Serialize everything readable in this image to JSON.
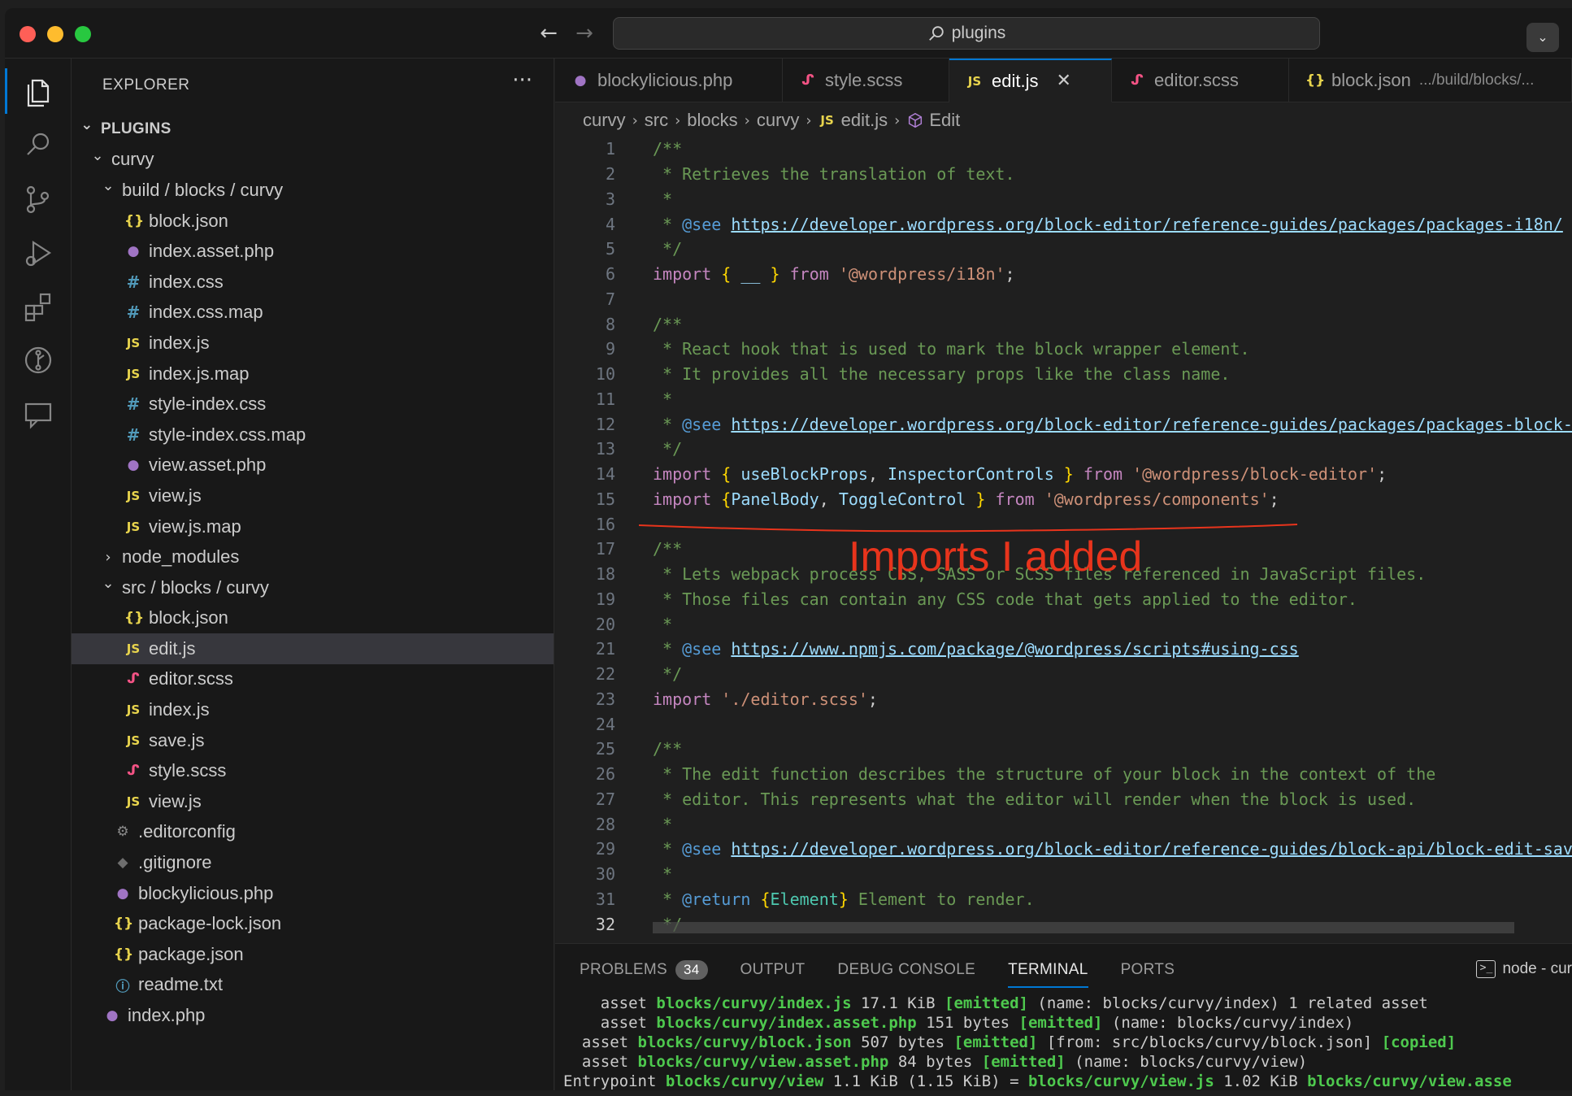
{
  "window": {
    "search_text": "plugins"
  },
  "sidebar": {
    "header": "EXPLORER",
    "more": "···",
    "tree": [
      {
        "indent": 0,
        "chevron": "v",
        "icon": "",
        "label": "PLUGINS",
        "section": true
      },
      {
        "indent": 1,
        "chevron": "v",
        "icon": "",
        "label": "curvy"
      },
      {
        "indent": 2,
        "chevron": "v",
        "icon": "",
        "label": "build / blocks / curvy"
      },
      {
        "indent": 3,
        "chevron": "",
        "icon": "json",
        "label": "block.json"
      },
      {
        "indent": 3,
        "chevron": "",
        "icon": "php",
        "label": "index.asset.php"
      },
      {
        "indent": 3,
        "chevron": "",
        "icon": "css",
        "label": "index.css"
      },
      {
        "indent": 3,
        "chevron": "",
        "icon": "css",
        "label": "index.css.map"
      },
      {
        "indent": 3,
        "chevron": "",
        "icon": "js",
        "label": "index.js"
      },
      {
        "indent": 3,
        "chevron": "",
        "icon": "js",
        "label": "index.js.map"
      },
      {
        "indent": 3,
        "chevron": "",
        "icon": "css",
        "label": "style-index.css"
      },
      {
        "indent": 3,
        "chevron": "",
        "icon": "css",
        "label": "style-index.css.map"
      },
      {
        "indent": 3,
        "chevron": "",
        "icon": "php",
        "label": "view.asset.php"
      },
      {
        "indent": 3,
        "chevron": "",
        "icon": "js",
        "label": "view.js"
      },
      {
        "indent": 3,
        "chevron": "",
        "icon": "js",
        "label": "view.js.map"
      },
      {
        "indent": 2,
        "chevron": ">",
        "icon": "",
        "label": "node_modules"
      },
      {
        "indent": 2,
        "chevron": "v",
        "icon": "",
        "label": "src / blocks / curvy"
      },
      {
        "indent": 3,
        "chevron": "",
        "icon": "json",
        "label": "block.json"
      },
      {
        "indent": 3,
        "chevron": "",
        "icon": "js",
        "label": "edit.js",
        "selected": true
      },
      {
        "indent": 3,
        "chevron": "",
        "icon": "scss",
        "label": "editor.scss"
      },
      {
        "indent": 3,
        "chevron": "",
        "icon": "js",
        "label": "index.js"
      },
      {
        "indent": 3,
        "chevron": "",
        "icon": "js",
        "label": "save.js"
      },
      {
        "indent": 3,
        "chevron": "",
        "icon": "scss",
        "label": "style.scss"
      },
      {
        "indent": 3,
        "chevron": "",
        "icon": "js",
        "label": "view.js"
      },
      {
        "indent": 2,
        "chevron": "",
        "icon": "gear",
        "label": ".editorconfig"
      },
      {
        "indent": 2,
        "chevron": "",
        "icon": "git",
        "label": ".gitignore"
      },
      {
        "indent": 2,
        "chevron": "",
        "icon": "php",
        "label": "blockylicious.php"
      },
      {
        "indent": 2,
        "chevron": "",
        "icon": "json",
        "label": "package-lock.json"
      },
      {
        "indent": 2,
        "chevron": "",
        "icon": "json",
        "label": "package.json"
      },
      {
        "indent": 2,
        "chevron": "",
        "icon": "info",
        "label": "readme.txt"
      },
      {
        "indent": 1,
        "chevron": "",
        "icon": "php",
        "label": "index.php"
      }
    ]
  },
  "editor": {
    "tabs": [
      {
        "icon": "php",
        "label": "blockylicious.php",
        "width": 280
      },
      {
        "icon": "scss",
        "label": "style.scss",
        "width": 205
      },
      {
        "icon": "js",
        "label": "edit.js",
        "width": 200,
        "active": true,
        "close": "✕"
      },
      {
        "icon": "scss",
        "label": "editor.scss",
        "width": 218
      },
      {
        "icon": "json",
        "label": "block.json",
        "desc": ".../build/blocks/...",
        "width": 348
      }
    ],
    "breadcrumbs": [
      "curvy",
      "src",
      "blocks",
      "curvy",
      "edit.js",
      "Edit"
    ],
    "current_line": 32,
    "lines": [
      [
        [
          "c-com",
          "/**"
        ]
      ],
      [
        [
          "c-com",
          " * Retrieves the translation of text."
        ]
      ],
      [
        [
          "c-com",
          " *"
        ]
      ],
      [
        [
          "c-com",
          " * "
        ],
        [
          "c-tag",
          "@see"
        ],
        [
          "c-com",
          " "
        ],
        [
          "c-link",
          "https://developer.wordpress.org/block-editor/reference-guides/packages/packages-i18n/"
        ]
      ],
      [
        [
          "c-com",
          " */"
        ]
      ],
      [
        [
          "c-kw",
          "import"
        ],
        [
          "c-pun",
          " "
        ],
        [
          "c-br",
          "{"
        ],
        [
          "c-pun",
          " "
        ],
        [
          "c-var",
          "__"
        ],
        [
          "c-pun",
          " "
        ],
        [
          "c-br",
          "}"
        ],
        [
          "c-pun",
          " "
        ],
        [
          "c-kw",
          "from"
        ],
        [
          "c-pun",
          " "
        ],
        [
          "c-str",
          "'@wordpress/i18n'"
        ],
        [
          "c-pun",
          ";"
        ]
      ],
      [],
      [
        [
          "c-com",
          "/**"
        ]
      ],
      [
        [
          "c-com",
          " * React hook that is used to mark the block wrapper element."
        ]
      ],
      [
        [
          "c-com",
          " * It provides all the necessary props like the class name."
        ]
      ],
      [
        [
          "c-com",
          " *"
        ]
      ],
      [
        [
          "c-com",
          " * "
        ],
        [
          "c-tag",
          "@see"
        ],
        [
          "c-com",
          " "
        ],
        [
          "c-link",
          "https://developer.wordpress.org/block-editor/reference-guides/packages/packages-block-editor/"
        ]
      ],
      [
        [
          "c-com",
          " */"
        ]
      ],
      [
        [
          "c-kw",
          "import"
        ],
        [
          "c-pun",
          " "
        ],
        [
          "c-br",
          "{"
        ],
        [
          "c-pun",
          " "
        ],
        [
          "c-var",
          "useBlockProps"
        ],
        [
          "c-pun",
          ", "
        ],
        [
          "c-var",
          "InspectorControls"
        ],
        [
          "c-pun",
          " "
        ],
        [
          "c-br",
          "}"
        ],
        [
          "c-pun",
          " "
        ],
        [
          "c-kw",
          "from"
        ],
        [
          "c-pun",
          " "
        ],
        [
          "c-str",
          "'@wordpress/block-editor'"
        ],
        [
          "c-pun",
          ";"
        ]
      ],
      [
        [
          "c-kw",
          "import"
        ],
        [
          "c-pun",
          " "
        ],
        [
          "c-br",
          "{"
        ],
        [
          "c-var",
          "PanelBody"
        ],
        [
          "c-pun",
          ", "
        ],
        [
          "c-var",
          "ToggleControl"
        ],
        [
          "c-pun",
          " "
        ],
        [
          "c-br",
          "}"
        ],
        [
          "c-pun",
          " "
        ],
        [
          "c-kw",
          "from"
        ],
        [
          "c-pun",
          " "
        ],
        [
          "c-str",
          "'@wordpress/components'"
        ],
        [
          "c-pun",
          ";"
        ]
      ],
      [],
      [
        [
          "c-com",
          "/**"
        ]
      ],
      [
        [
          "c-com",
          " * Lets webpack process CSS, SASS or SCSS files referenced in JavaScript files."
        ]
      ],
      [
        [
          "c-com",
          " * Those files can contain any CSS code that gets applied to the editor."
        ]
      ],
      [
        [
          "c-com",
          " *"
        ]
      ],
      [
        [
          "c-com",
          " * "
        ],
        [
          "c-tag",
          "@see"
        ],
        [
          "c-com",
          " "
        ],
        [
          "c-link",
          "https://www.npmjs.com/package/@wordpress/scripts#using-css"
        ]
      ],
      [
        [
          "c-com",
          " */"
        ]
      ],
      [
        [
          "c-kw",
          "import"
        ],
        [
          "c-pun",
          " "
        ],
        [
          "c-str",
          "'./editor.scss'"
        ],
        [
          "c-pun",
          ";"
        ]
      ],
      [],
      [
        [
          "c-com",
          "/**"
        ]
      ],
      [
        [
          "c-com",
          " * The edit function describes the structure of your block in the context of the"
        ]
      ],
      [
        [
          "c-com",
          " * editor. This represents what the editor will render when the block is used."
        ]
      ],
      [
        [
          "c-com",
          " *"
        ]
      ],
      [
        [
          "c-com",
          " * "
        ],
        [
          "c-tag",
          "@see"
        ],
        [
          "c-com",
          " "
        ],
        [
          "c-link",
          "https://developer.wordpress.org/block-editor/reference-guides/block-api/block-edit-save/"
        ]
      ],
      [
        [
          "c-com",
          " *"
        ]
      ],
      [
        [
          "c-com",
          " * "
        ],
        [
          "c-tag",
          "@return"
        ],
        [
          "c-com",
          " "
        ],
        [
          "c-br",
          "{"
        ],
        [
          "c-type",
          "Element"
        ],
        [
          "c-br",
          "}"
        ],
        [
          "c-com",
          " Element to render."
        ]
      ],
      [
        [
          "c-com",
          " */"
        ]
      ]
    ],
    "annotation": "Imports I added"
  },
  "panel": {
    "tabs": [
      {
        "label": "PROBLEMS",
        "badge": "34"
      },
      {
        "label": "OUTPUT"
      },
      {
        "label": "DEBUG CONSOLE"
      },
      {
        "label": "TERMINAL",
        "active": true
      },
      {
        "label": "PORTS"
      }
    ],
    "terminal_name": "node - cur",
    "terminal_lines": [
      [
        [
          "",
          "    asset "
        ],
        [
          "t-g",
          "blocks/curvy/index.js"
        ],
        [
          "",
          " 17.1 KiB "
        ],
        [
          "t-g",
          "[emitted]"
        ],
        [
          "",
          " (name: blocks/curvy/index) 1 related asset"
        ]
      ],
      [
        [
          "",
          "    asset "
        ],
        [
          "t-g",
          "blocks/curvy/index.asset.php"
        ],
        [
          "",
          " 151 bytes "
        ],
        [
          "t-g",
          "[emitted]"
        ],
        [
          "",
          " (name: blocks/curvy/index)"
        ]
      ],
      [
        [
          "",
          "  asset "
        ],
        [
          "t-g",
          "blocks/curvy/block.json"
        ],
        [
          "",
          " 507 bytes "
        ],
        [
          "t-g",
          "[emitted]"
        ],
        [
          "",
          " [from: src/blocks/curvy/block.json] "
        ],
        [
          "t-g",
          "[copied]"
        ]
      ],
      [
        [
          "",
          "  asset "
        ],
        [
          "t-g",
          "blocks/curvy/view.asset.php"
        ],
        [
          "",
          " 84 bytes "
        ],
        [
          "t-g",
          "[emitted]"
        ],
        [
          "",
          " (name: blocks/curvy/view)"
        ]
      ],
      [
        [
          "",
          "Entrypoint "
        ],
        [
          "t-g",
          "blocks/curvy/view"
        ],
        [
          "",
          " 1.1 KiB (1.15 KiB) = "
        ],
        [
          "t-g",
          "blocks/curvy/view.js"
        ],
        [
          "",
          " 1.02 KiB "
        ],
        [
          "t-g",
          "blocks/curvy/view.asse"
        ]
      ]
    ]
  },
  "colors": {
    "accent": "#0078d4",
    "annotation": "#e8341c",
    "terminal_green": "#4ec94e"
  }
}
